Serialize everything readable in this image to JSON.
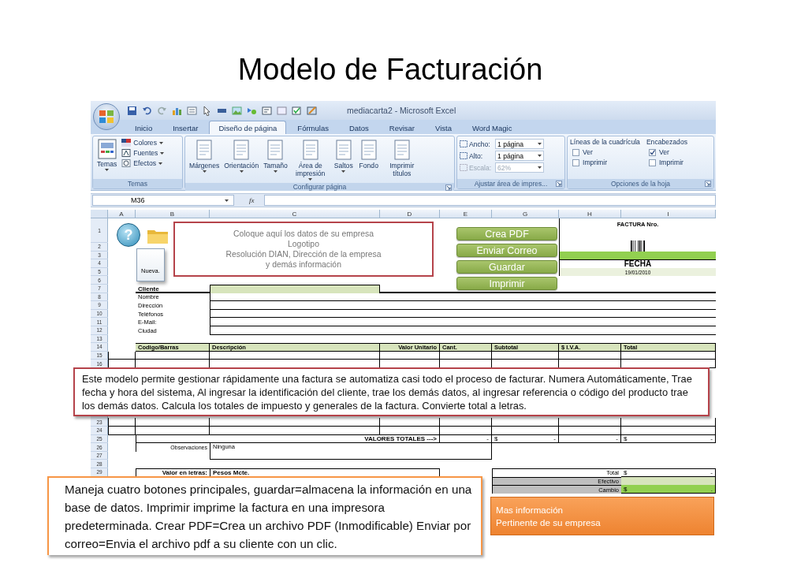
{
  "slide_title": "Modelo de Facturación",
  "window": {
    "title": "mediacarta2 - Microsoft Excel"
  },
  "tabs": [
    {
      "label": "Inicio",
      "selected": false
    },
    {
      "label": "Insertar",
      "selected": false
    },
    {
      "label": "Diseño de página",
      "selected": true
    },
    {
      "label": "Fórmulas",
      "selected": false
    },
    {
      "label": "Datos",
      "selected": false
    },
    {
      "label": "Revisar",
      "selected": false
    },
    {
      "label": "Vista",
      "selected": false
    },
    {
      "label": "Word Magic",
      "selected": false
    }
  ],
  "ribbon_groups": [
    {
      "label": "Temas",
      "kind": "buttons",
      "launcher": false,
      "items": [
        {
          "kind": "large",
          "label": "Temas",
          "dropdown": true
        },
        {
          "kind": "small",
          "label": "Colores",
          "dropdown": true
        },
        {
          "kind": "small",
          "label": "Fuentes",
          "dropdown": true
        },
        {
          "kind": "small",
          "label": "Efectos",
          "dropdown": true
        }
      ]
    },
    {
      "label": "Configurar página",
      "kind": "buttons",
      "launcher": true,
      "items": [
        {
          "kind": "large",
          "label": "Márgenes",
          "dropdown": true
        },
        {
          "kind": "large",
          "label": "Orientación",
          "dropdown": true
        },
        {
          "kind": "large",
          "label": "Tamaño",
          "dropdown": true
        },
        {
          "kind": "large",
          "label": "Área de impresión",
          "dropdown": true
        },
        {
          "kind": "large",
          "label": "Saltos",
          "dropdown": true
        },
        {
          "kind": "large",
          "label": "Fondo",
          "dropdown": false
        },
        {
          "kind": "large",
          "label": "Imprimir títulos",
          "dropdown": false
        }
      ]
    },
    {
      "label": "Ajustar área de impres...",
      "kind": "spinners",
      "launcher": true,
      "items": [
        {
          "label": "Ancho:",
          "value": "1 página",
          "disabled": false
        },
        {
          "label": "Alto:",
          "value": "1 página",
          "disabled": false
        },
        {
          "label": "Escala:",
          "value": "62%",
          "disabled": true
        }
      ]
    },
    {
      "label": "Opciones de la hoja",
      "kind": "checks",
      "launcher": true,
      "columns": [
        {
          "heading": "Líneas de la cuadrícula",
          "items": [
            {
              "label": "Ver",
              "checked": false
            },
            {
              "label": "Imprimir",
              "checked": false
            }
          ]
        },
        {
          "heading": "Encabezados",
          "items": [
            {
              "label": "Ver",
              "checked": true
            },
            {
              "label": "Imprimir",
              "checked": false
            }
          ]
        }
      ]
    }
  ],
  "formula_bar": {
    "name_box": "M36",
    "function_label": "fx"
  },
  "columns": [
    "A",
    "B",
    "C",
    "D",
    "E",
    "G",
    "H",
    "I"
  ],
  "rows": [
    {
      "number": "1",
      "cells": {
        "H": {
          "kind": "title",
          "text": "FACTURA Nro."
        }
      }
    },
    {
      "number": "2",
      "cells": {
        "H": {
          "kind": "barcode"
        }
      }
    },
    {
      "number": "3",
      "cells": {
        "H": {
          "kind": "highlight"
        }
      }
    },
    {
      "number": "4",
      "cells": {
        "H": {
          "kind": "title-line",
          "text": "FECHA"
        }
      }
    },
    {
      "number": "5",
      "cells": {
        "H": {
          "kind": "date",
          "text": "19/01/2010"
        }
      }
    },
    {
      "number": "6"
    },
    {
      "number": "7",
      "cells": {
        "B": {
          "kind": "label-rule",
          "text": "Cliente"
        },
        "C": {
          "kind": "input"
        }
      }
    },
    {
      "number": "8",
      "cells": {
        "B": {
          "kind": "label",
          "text": "Nombre"
        },
        "C": {
          "kind": "line"
        }
      }
    },
    {
      "number": "9",
      "cells": {
        "B": {
          "kind": "label",
          "text": "Dirección"
        },
        "C": {
          "kind": "line"
        }
      }
    },
    {
      "number": "10",
      "cells": {
        "B": {
          "kind": "label",
          "text": "Teléfonos"
        },
        "C": {
          "kind": "line"
        }
      }
    },
    {
      "number": "11",
      "cells": {
        "B": {
          "kind": "label",
          "text": "E-Mail:"
        },
        "C": {
          "kind": "line"
        }
      }
    },
    {
      "number": "12",
      "cells": {
        "B": {
          "kind": "label",
          "text": "Ciudad"
        },
        "C": {
          "kind": "line"
        }
      }
    },
    {
      "number": "13"
    },
    {
      "number": "14",
      "cells": {
        "B": {
          "kind": "head",
          "text": "Codigo/Barras"
        },
        "C": {
          "kind": "head",
          "text": "Descripción"
        },
        "D": {
          "kind": "head-right",
          "text": "Valor Unitario"
        },
        "E": {
          "kind": "head",
          "text": "Cant."
        },
        "G": {
          "kind": "head",
          "text": "Subtotal"
        },
        "H": {
          "kind": "head",
          "text": "$ I.V.A."
        },
        "I": {
          "kind": "head",
          "text": "Total"
        }
      }
    },
    {
      "number": "15",
      "kind": "table"
    },
    {
      "number": "16",
      "kind": "table"
    },
    {
      "number": "23",
      "kind": "table"
    },
    {
      "number": "24",
      "kind": "table"
    },
    {
      "number": "25",
      "cells": {
        "B": {
          "kind": "total-label",
          "text": "VALORES TOTALES --->"
        },
        "E": {
          "kind": "amount",
          "text": "-"
        },
        "G": {
          "kind": "amount",
          "currency": "$",
          "text": "-"
        },
        "H": {
          "kind": "amount",
          "text": "-"
        },
        "I": {
          "kind": "amount",
          "currency": "$",
          "text": "-"
        }
      }
    },
    {
      "number": "26",
      "cells": {
        "B": {
          "kind": "label-right",
          "text": "Observaciones"
        },
        "C": {
          "kind": "note",
          "text": "Ninguna"
        }
      }
    },
    {
      "number": "27"
    },
    {
      "number": "28"
    },
    {
      "number": "29",
      "cells": {
        "B": {
          "kind": "label-right-bold",
          "text": "Valor en letras:"
        },
        "C": {
          "kind": "words",
          "text": "Pesos Mcte."
        },
        "G": {
          "kind": "sum-label",
          "text": "Total"
        },
        "I": {
          "kind": "sum",
          "currency": "$",
          "text": "-"
        }
      }
    },
    {
      "cells": {
        "G": {
          "kind": "sum-label-gray",
          "text": "Efectivo"
        },
        "I": {
          "kind": "sum-light"
        }
      }
    },
    {
      "cells": {
        "G": {
          "kind": "sum-label-gray",
          "text": "Cambio"
        },
        "I": {
          "kind": "sum-green",
          "currency": "$",
          "text": "."
        }
      }
    }
  ],
  "help_icon_glyph": "?",
  "new_file_label": "Nueva.",
  "company_box": {
    "lines": [
      "Coloque aquí los datos de su empresa",
      "Logotipo",
      "Resolución DIAN, Dirección de la empresa",
      "y demás información"
    ]
  },
  "action_buttons": [
    "Crea PDF",
    "Enviar Correo",
    "Guardar",
    "Imprimir"
  ],
  "info_banner": {
    "lines": [
      "Mas información",
      "Pertinente de su empresa"
    ]
  },
  "callouts": [
    {
      "kind": "red",
      "text": "Este modelo permite gestionar rápidamente una factura se automatiza casi todo el proceso de facturar. Numera Automáticamente, Trae fecha y hora del sistema, Al ingresar la identificación del cliente, trae los demás datos, al ingresar referencia o código del producto trae los demás datos. Calcula los totales de impuesto y generales de la factura. Convierte total a letras."
    },
    {
      "kind": "orange",
      "text": "Maneja cuatro botones principales, guardar=almacena la información en una base de datos. Imprimir imprime la factura en una impresora predeterminada. Crear PDF=Crea un archivo PDF (Inmodificable) Enviar por correo=Envia el archivo pdf a su cliente con un clic."
    }
  ]
}
